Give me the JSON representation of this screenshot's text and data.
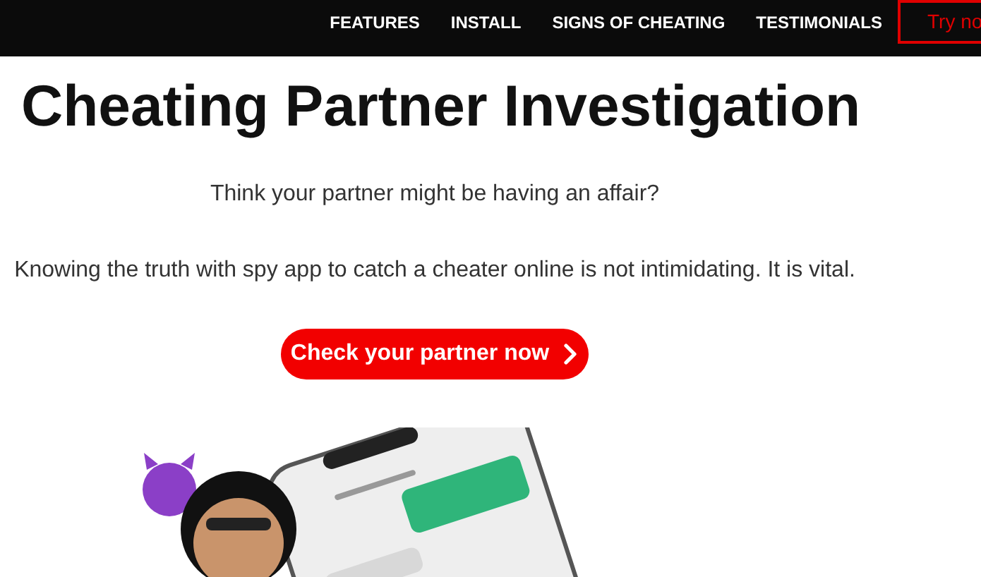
{
  "nav": {
    "items": [
      {
        "label": "FEATURES"
      },
      {
        "label": "INSTALL"
      },
      {
        "label": "SIGNS OF CHEATING"
      },
      {
        "label": "TESTIMONIALS"
      }
    ],
    "cta": "Try no"
  },
  "hero": {
    "title": "Cheating Partner Investigation",
    "question": "Think your partner might be having an affair?",
    "statement": "Knowing the truth with spy app to catch a cheater online is not intimidating. It is vital.",
    "button": "Check your partner now"
  }
}
